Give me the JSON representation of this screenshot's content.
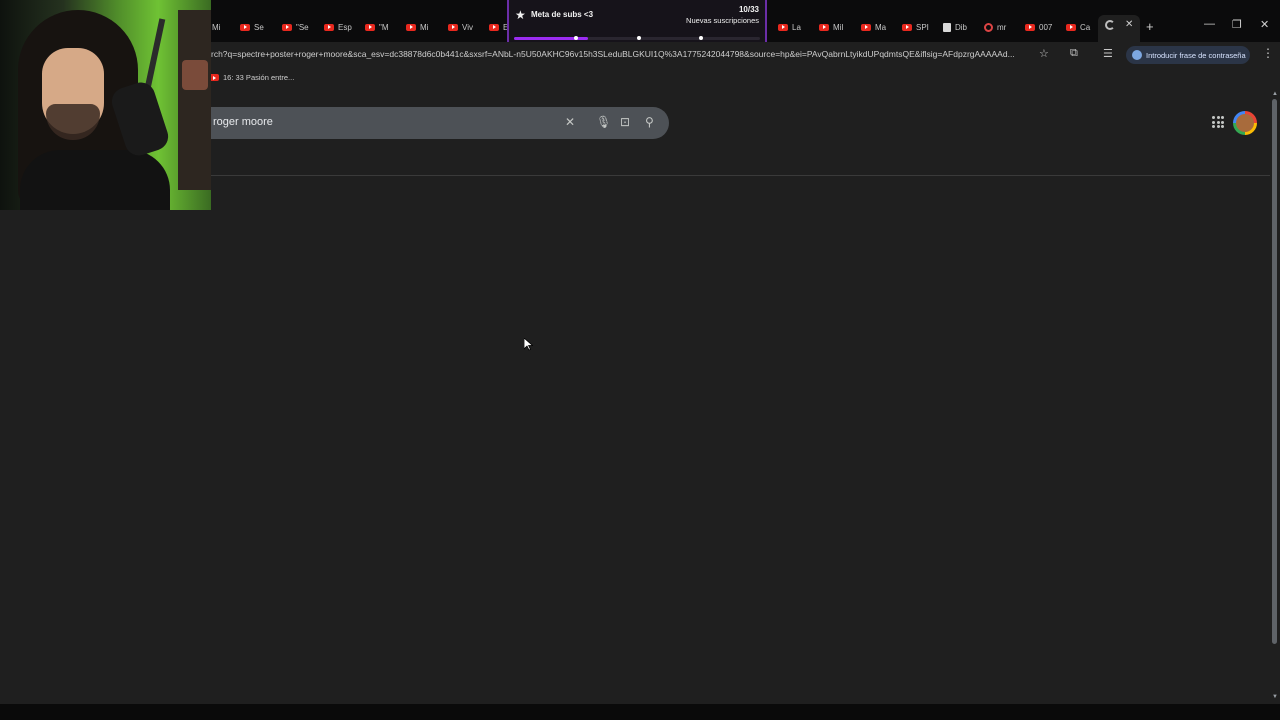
{
  "browser": {
    "tabs": [
      {
        "label": "Mi",
        "favicon": "youtube-icon"
      },
      {
        "label": "Se",
        "favicon": "youtube-icon"
      },
      {
        "label": "\"Se",
        "favicon": "youtube-icon"
      },
      {
        "label": "Esp",
        "favicon": "youtube-icon"
      },
      {
        "label": "\"M",
        "favicon": "youtube-icon"
      },
      {
        "label": "Mi",
        "favicon": "youtube-icon"
      },
      {
        "label": "Viv",
        "favicon": "youtube-icon"
      },
      {
        "label": "E",
        "favicon": "youtube-icon"
      },
      {
        "label": "La",
        "favicon": "youtube-icon"
      },
      {
        "label": "Mil",
        "favicon": "youtube-icon"
      },
      {
        "label": "Ma",
        "favicon": "youtube-icon"
      },
      {
        "label": "SPI",
        "favicon": "youtube-icon"
      },
      {
        "label": "Dib",
        "favicon": "document-icon"
      },
      {
        "label": "mr",
        "favicon": "circle-icon"
      },
      {
        "label": "007",
        "favicon": "youtube-icon"
      },
      {
        "label": "Ca",
        "favicon": "youtube-icon"
      }
    ],
    "active_tab": {
      "favicon": "google-icon"
    },
    "url": "rch?q=spectre+poster+roger+moore&sca_esv=dc38878d6c0b441c&sxsrf=ANbL-n5U50AKHC96v15h3SLeduBLGKUI1Q%3A1775242044798&source=hp&ei=PAvQabrnLtyikdUPqdmtsQE&iflsig=AFdpzrgAAAAAd...",
    "password_pill": "Introducir frase de contraseña",
    "bookmark": "16: 33 Pasión entre..."
  },
  "subs_goal": {
    "title": "Meta de subs <3",
    "count": "10/33",
    "caption": "Nuevas suscripciones",
    "progress": 0.3,
    "accent": "#9b2cf2"
  },
  "search": {
    "query": "roger moore"
  },
  "colors": {
    "page_bg": "#1f1f1f",
    "searchbox_bg": "#4d5156",
    "tabstrip_bg": "#0b0b0c"
  }
}
